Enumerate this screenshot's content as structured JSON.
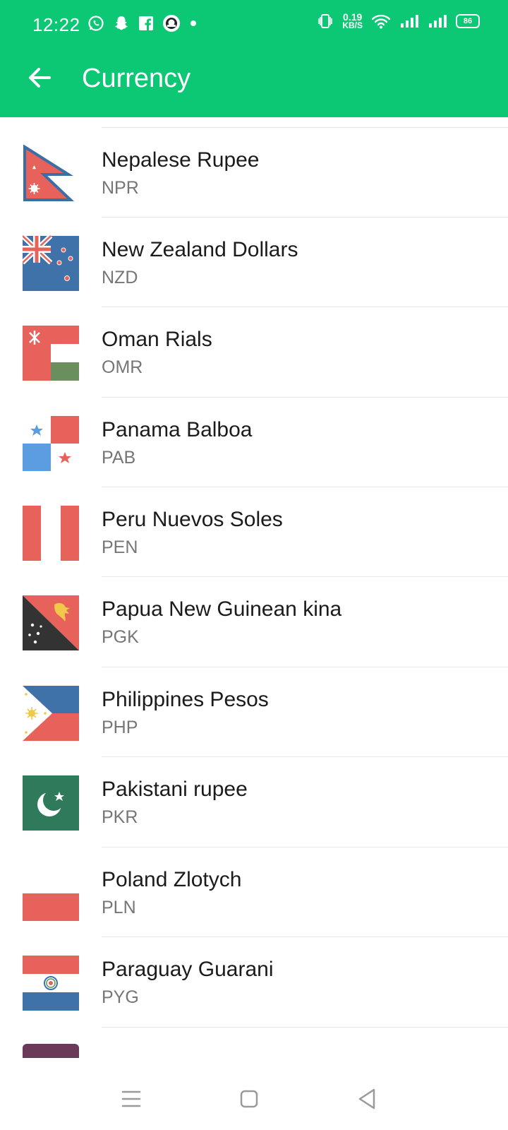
{
  "status_bar": {
    "time": "12:22",
    "net_speed_value": "0.19",
    "net_speed_unit": "KB/S",
    "battery": "86",
    "notification_icons": [
      "whatsapp-icon",
      "snapchat-icon",
      "facebook-icon",
      "app-icon",
      "dot-icon"
    ],
    "system_icons": [
      "vibrate-icon",
      "wifi-icon",
      "signal-icon",
      "signal-icon",
      "battery-icon"
    ]
  },
  "header": {
    "title": "Currency",
    "back_icon": "arrow-back-icon",
    "background_color": "#0cc773"
  },
  "currencies": [
    {
      "name": "Nepalese Rupee",
      "code": "NPR",
      "flag_icon": "flag-nepal-icon"
    },
    {
      "name": "New Zealand Dollars",
      "code": "NZD",
      "flag_icon": "flag-new-zealand-icon"
    },
    {
      "name": "Oman Rials",
      "code": "OMR",
      "flag_icon": "flag-oman-icon"
    },
    {
      "name": "Panama Balboa",
      "code": "PAB",
      "flag_icon": "flag-panama-icon"
    },
    {
      "name": "Peru Nuevos Soles",
      "code": "PEN",
      "flag_icon": "flag-peru-icon"
    },
    {
      "name": "Papua New Guinean kina",
      "code": "PGK",
      "flag_icon": "flag-papua-new-guinea-icon"
    },
    {
      "name": "Philippines Pesos",
      "code": "PHP",
      "flag_icon": "flag-philippines-icon"
    },
    {
      "name": "Pakistani rupee",
      "code": "PKR",
      "flag_icon": "flag-pakistan-icon"
    },
    {
      "name": "Poland Zlotych",
      "code": "PLN",
      "flag_icon": "flag-poland-icon"
    },
    {
      "name": "Paraguay Guarani",
      "code": "PYG",
      "flag_icon": "flag-paraguay-icon"
    }
  ],
  "nav_bar": {
    "icons": [
      "menu-icon",
      "home-square-icon",
      "back-triangle-icon"
    ]
  }
}
